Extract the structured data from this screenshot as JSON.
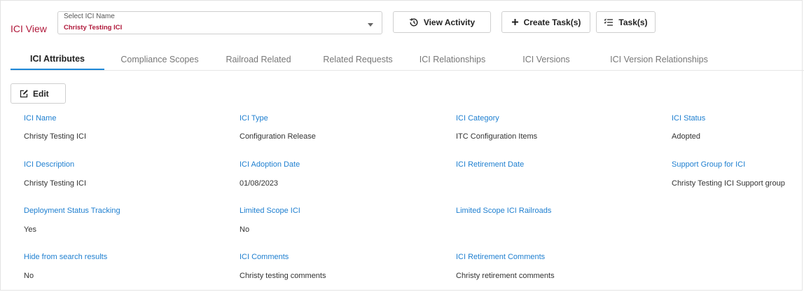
{
  "header": {
    "title": "ICI View",
    "select": {
      "label": "Select ICI Name",
      "value": "Christy Testing ICI"
    },
    "buttons": {
      "view_activity": "View Activity",
      "create_tasks": "Create Task(s)",
      "tasks": "Task(s)"
    }
  },
  "tabs": [
    {
      "label": "ICI Attributes",
      "active": true
    },
    {
      "label": "Compliance Scopes"
    },
    {
      "label": "Railroad Related"
    },
    {
      "label": "Related Requests"
    },
    {
      "label": "ICI Relationships"
    },
    {
      "label": "ICI Versions"
    },
    {
      "label": "ICI Version Relationships"
    }
  ],
  "edit_label": "Edit",
  "fields": {
    "ici_name": {
      "label": "ICI Name",
      "value": "Christy Testing ICI"
    },
    "ici_type": {
      "label": "ICI Type",
      "value": "Configuration Release"
    },
    "ici_category": {
      "label": "ICI Category",
      "value": "ITC Configuration Items"
    },
    "ici_status": {
      "label": "ICI Status",
      "value": "Adopted"
    },
    "ici_description": {
      "label": "ICI Description",
      "value": "Christy Testing ICI"
    },
    "ici_adoption_date": {
      "label": "ICI Adoption Date",
      "value": "01/08/2023"
    },
    "ici_retirement_date": {
      "label": "ICI Retirement Date",
      "value": ""
    },
    "support_group": {
      "label": "Support Group for ICI",
      "value": "Christy Testing ICI Support group"
    },
    "deployment_status_tracking": {
      "label": "Deployment Status Tracking",
      "value": "Yes"
    },
    "limited_scope_ici": {
      "label": "Limited Scope ICI",
      "value": "No"
    },
    "limited_scope_railroads": {
      "label": "Limited Scope ICI Railroads",
      "value": ""
    },
    "hide_from_search": {
      "label": "Hide from search results",
      "value": "No"
    },
    "ici_comments": {
      "label": "ICI Comments",
      "value": "Christy testing comments"
    },
    "ici_retirement_comments": {
      "label": "ICI Retirement Comments",
      "value": "Christy retirement comments"
    }
  },
  "colors": {
    "accent_red": "#b0183a",
    "label_blue": "#1e7fd0",
    "tab_underline": "#1e88d8"
  }
}
